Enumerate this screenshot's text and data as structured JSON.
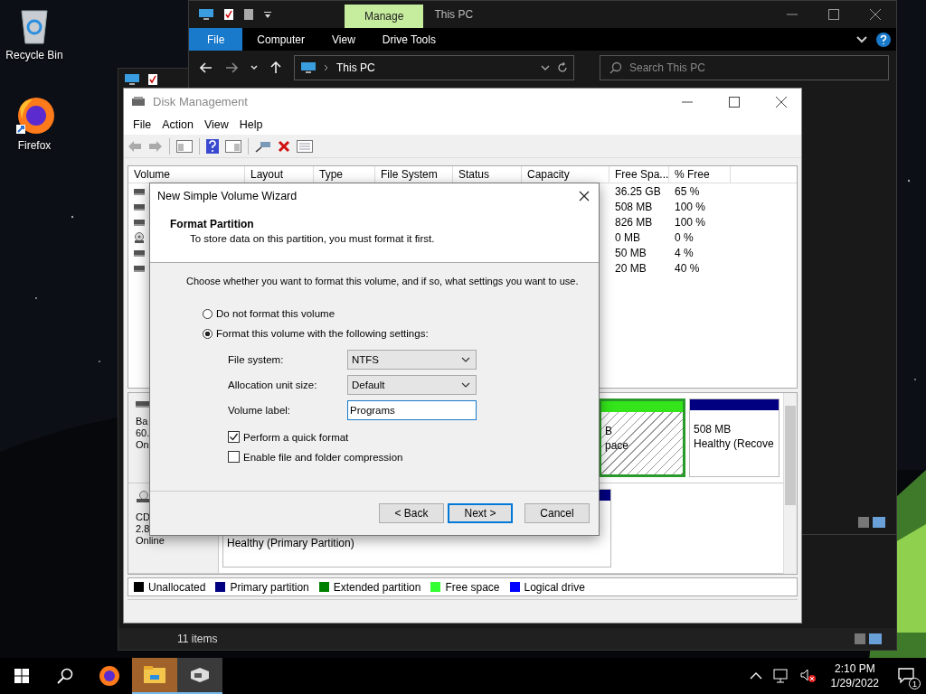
{
  "desktop": {
    "icons": [
      {
        "label": "Recycle Bin",
        "kind": "recycle-bin"
      },
      {
        "label": "Firefox",
        "kind": "firefox"
      }
    ]
  },
  "explorer_back": {
    "status": "11 items"
  },
  "explorer": {
    "title": "This PC",
    "context_tab": "Manage",
    "ribbon_tabs": [
      {
        "label": "File",
        "selected": true
      },
      {
        "label": "Computer",
        "selected": false
      },
      {
        "label": "View",
        "selected": false
      },
      {
        "label": "Drive Tools",
        "selected": false
      }
    ],
    "address": "This PC",
    "search": {
      "placeholder": "Search This PC"
    }
  },
  "disk_management": {
    "title": "Disk Management",
    "menu": [
      "File",
      "Action",
      "View",
      "Help"
    ],
    "columns": [
      "Volume",
      "Layout",
      "Type",
      "File System",
      "Status",
      "Capacity",
      "Free Spa...",
      "% Free"
    ],
    "rows": [
      {
        "kind": "drive",
        "free": "36.25 GB",
        "pct_free": "65 %"
      },
      {
        "kind": "drive",
        "free": "508 MB",
        "pct_free": "100 %"
      },
      {
        "kind": "drive",
        "free": "826 MB",
        "pct_free": "100 %"
      },
      {
        "kind": "cd",
        "free": "0 MB",
        "pct_free": "0 %"
      },
      {
        "kind": "drive",
        "free": "50 MB",
        "pct_free": "4 %"
      },
      {
        "kind": "drive",
        "free": "20 MB",
        "pct_free": "40 %"
      }
    ],
    "disks": [
      {
        "kind": "disk",
        "label_lines": [
          "Ba",
          "60.",
          "On"
        ],
        "partitions": [
          {
            "kind": "free",
            "lines": [
              "B",
              "pace"
            ],
            "selected": true
          },
          {
            "kind": "primary",
            "lines": [
              "508 MB",
              "Healthy (Recove"
            ],
            "selected": false
          }
        ]
      },
      {
        "kind": "cd",
        "label_lines": [
          "CD",
          "2.8",
          "Online"
        ],
        "partitions": [
          {
            "kind": "primary",
            "lines": [
              "Healthy (Primary Partition)"
            ],
            "selected": false
          }
        ]
      }
    ],
    "legend": [
      {
        "label": "Unallocated",
        "color": "#000000"
      },
      {
        "label": "Primary partition",
        "color": "#000080"
      },
      {
        "label": "Extended partition",
        "color": "#008000"
      },
      {
        "label": "Free space",
        "color": "#33ff33"
      },
      {
        "label": "Logical drive",
        "color": "#0000ff"
      }
    ]
  },
  "wizard": {
    "title": "New Simple Volume Wizard",
    "heading": "Format Partition",
    "subtitle": "To store data on this partition, you must format it first.",
    "prompt": "Choose whether you want to format this volume, and if so, what settings you want to use.",
    "radios": [
      {
        "label": "Do not format this volume",
        "selected": false
      },
      {
        "label": "Format this volume with the following settings:",
        "selected": true
      }
    ],
    "fields": [
      {
        "kind": "select",
        "label": "File system:",
        "value": "NTFS"
      },
      {
        "kind": "select",
        "label": "Allocation unit size:",
        "value": "Default"
      },
      {
        "kind": "text",
        "label": "Volume label:",
        "value": "Programs"
      }
    ],
    "checks": [
      {
        "label": "Perform a quick format",
        "checked": true
      },
      {
        "label": "Enable file and folder compression",
        "checked": false
      }
    ],
    "buttons": [
      {
        "label": "< Back",
        "default": false
      },
      {
        "label": "Next >",
        "default": true
      },
      {
        "label": "Cancel",
        "default": false
      }
    ]
  },
  "taskbar": {
    "apps": [
      {
        "kind": "firefox",
        "active": false
      },
      {
        "kind": "explorer",
        "active": true
      },
      {
        "kind": "disk-management",
        "active": true
      }
    ],
    "time": "2:10 PM",
    "date": "1/29/2022",
    "notifications": "1"
  }
}
